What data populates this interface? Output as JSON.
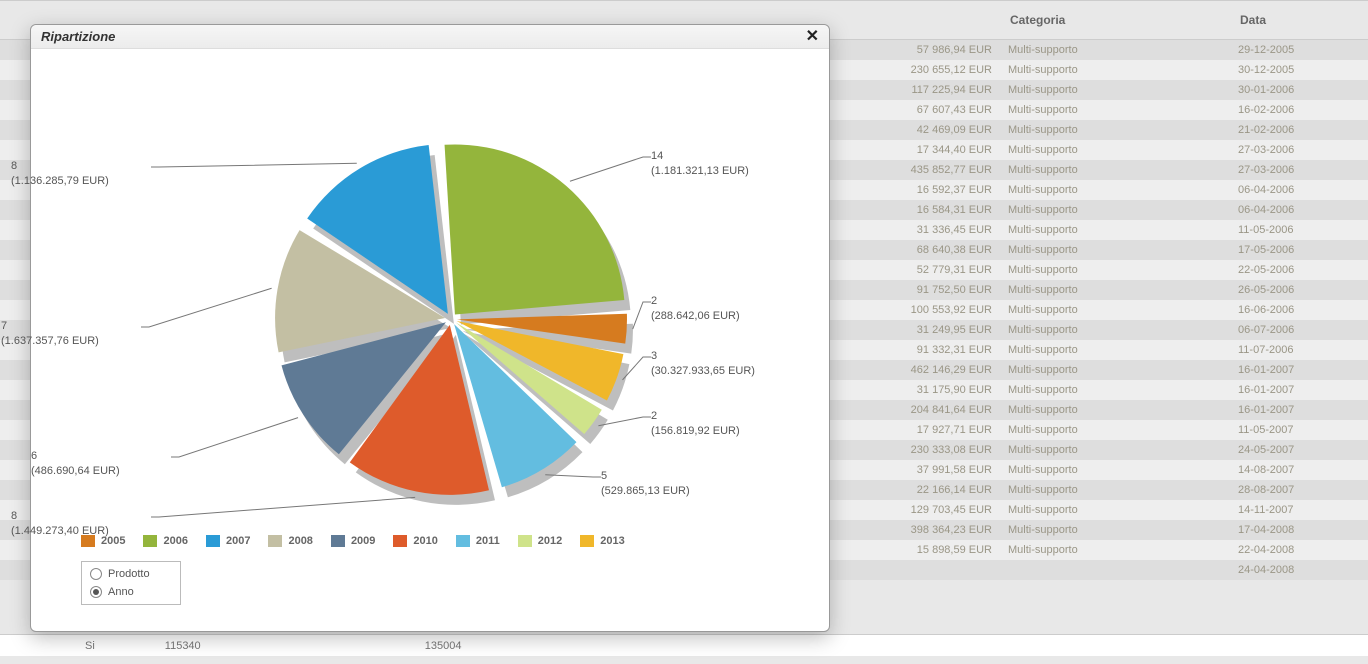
{
  "modal": {
    "title": "Ripartizione",
    "close": "✕",
    "options": {
      "prodotto": "Prodotto",
      "anno": "Anno"
    }
  },
  "chart_data": {
    "type": "pie",
    "title": "Ripartizione",
    "series": [
      {
        "year": "2005",
        "count": 2,
        "amount_label": "288.642,06 EUR",
        "color": "#d67b1f"
      },
      {
        "year": "2006",
        "count": 14,
        "amount_label": "1.181.321,13 EUR",
        "color": "#94b53c"
      },
      {
        "year": "2007",
        "count": 8,
        "amount_label": "1.136.285,79 EUR",
        "color": "#2a9bd6"
      },
      {
        "year": "2008",
        "count": 7,
        "amount_label": "1.637.357,76 EUR",
        "color": "#c3bfa3"
      },
      {
        "year": "2009",
        "count": 6,
        "amount_label": "486.690,64 EUR",
        "color": "#5f7a95"
      },
      {
        "year": "2010",
        "count": 8,
        "amount_label": "1.449.273,40 EUR",
        "color": "#de5b2b"
      },
      {
        "year": "2011",
        "count": 5,
        "amount_label": "529.865,13 EUR",
        "color": "#63bde0"
      },
      {
        "year": "2012",
        "count": 2,
        "amount_label": "156.819,92 EUR",
        "color": "#cfe38a"
      },
      {
        "year": "2013",
        "count": 3,
        "amount_label": "30.327.933,65 EUR",
        "color": "#f0b72a"
      }
    ],
    "legend_order": [
      "2005",
      "2006",
      "2007",
      "2008",
      "2009",
      "2010",
      "2011",
      "2012",
      "2013"
    ]
  },
  "table": {
    "headers": {
      "categoria": "Categoria",
      "data": "Data"
    },
    "rows": [
      {
        "amount": "57 986,94 EUR",
        "cat": "Multi-supporto",
        "date": "29-12-2005"
      },
      {
        "amount": "230 655,12 EUR",
        "cat": "Multi-supporto",
        "date": "30-12-2005"
      },
      {
        "amount": "117 225,94 EUR",
        "cat": "Multi-supporto",
        "date": "30-01-2006"
      },
      {
        "amount": "67 607,43 EUR",
        "cat": "Multi-supporto",
        "date": "16-02-2006"
      },
      {
        "amount": "42 469,09 EUR",
        "cat": "Multi-supporto",
        "date": "21-02-2006"
      },
      {
        "amount": "17 344,40 EUR",
        "cat": "Multi-supporto",
        "date": "27-03-2006"
      },
      {
        "amount": "435 852,77 EUR",
        "cat": "Multi-supporto",
        "date": "27-03-2006"
      },
      {
        "amount": "16 592,37 EUR",
        "cat": "Multi-supporto",
        "date": "06-04-2006"
      },
      {
        "amount": "16 584,31 EUR",
        "cat": "Multi-supporto",
        "date": "06-04-2006"
      },
      {
        "amount": "31 336,45 EUR",
        "cat": "Multi-supporto",
        "date": "11-05-2006"
      },
      {
        "amount": "68 640,38 EUR",
        "cat": "Multi-supporto",
        "date": "17-05-2006"
      },
      {
        "amount": "52 779,31 EUR",
        "cat": "Multi-supporto",
        "date": "22-05-2006"
      },
      {
        "amount": "91 752,50 EUR",
        "cat": "Multi-supporto",
        "date": "26-05-2006"
      },
      {
        "amount": "100 553,92 EUR",
        "cat": "Multi-supporto",
        "date": "16-06-2006"
      },
      {
        "amount": "31 249,95 EUR",
        "cat": "Multi-supporto",
        "date": "06-07-2006"
      },
      {
        "amount": "91 332,31 EUR",
        "cat": "Multi-supporto",
        "date": "11-07-2006"
      },
      {
        "amount": "462 146,29 EUR",
        "cat": "Multi-supporto",
        "date": "16-01-2007"
      },
      {
        "amount": "31 175,90 EUR",
        "cat": "Multi-supporto",
        "date": "16-01-2007"
      },
      {
        "amount": "204 841,64 EUR",
        "cat": "Multi-supporto",
        "date": "16-01-2007"
      },
      {
        "amount": "17 927,71 EUR",
        "cat": "Multi-supporto",
        "date": "11-05-2007"
      },
      {
        "amount": "230 333,08 EUR",
        "cat": "Multi-supporto",
        "date": "24-05-2007"
      },
      {
        "amount": "37 991,58 EUR",
        "cat": "Multi-supporto",
        "date": "14-08-2007"
      },
      {
        "amount": "22 166,14 EUR",
        "cat": "Multi-supporto",
        "date": "28-08-2007"
      },
      {
        "amount": "129 703,45 EUR",
        "cat": "Multi-supporto",
        "date": "14-11-2007"
      },
      {
        "amount": "398 364,23 EUR",
        "cat": "Multi-supporto",
        "date": "17-04-2008"
      },
      {
        "amount": "15 898,59 EUR",
        "cat": "Multi-supporto",
        "date": "22-04-2008"
      },
      {
        "amount": "",
        "cat": "",
        "date": "24-04-2008"
      }
    ]
  },
  "bottom": {
    "c1": "Si",
    "c2": "115340",
    "c3": "135004"
  }
}
